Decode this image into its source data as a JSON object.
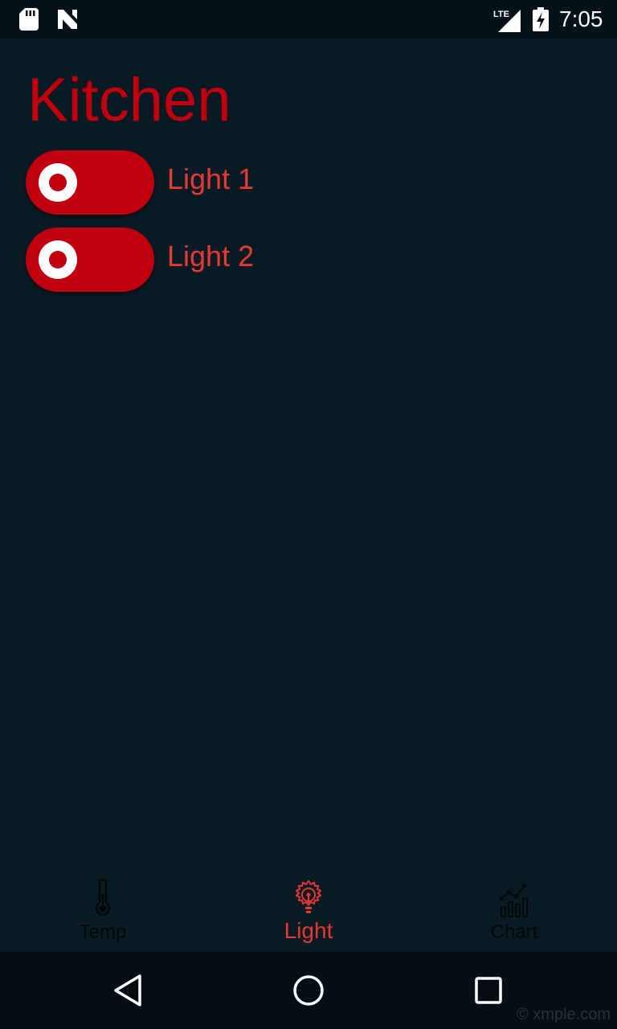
{
  "status_bar": {
    "time": "7:05",
    "icons": [
      "sd-card-icon",
      "n-notification-icon",
      "lte-signal-icon",
      "battery-charging-icon"
    ]
  },
  "page": {
    "title": "Kitchen"
  },
  "lights": [
    {
      "label": "Light 1",
      "state": "on"
    },
    {
      "label": "Light 2",
      "state": "on"
    }
  ],
  "bottom_nav": {
    "items": [
      {
        "label": "Temp",
        "icon": "thermometer-icon",
        "active": false
      },
      {
        "label": "Light",
        "icon": "lightbulb-icon",
        "active": true
      },
      {
        "label": "Chart",
        "icon": "chart-icon",
        "active": false
      }
    ]
  },
  "system_nav": {
    "buttons": [
      "back-icon",
      "home-icon",
      "recents-icon"
    ]
  },
  "watermark": "© xmple.com",
  "colors": {
    "accent": "#c0000f",
    "label": "#e53935",
    "background": "#0a1a22",
    "status_bar": "#05121a",
    "nav_bar": "#040e14"
  }
}
